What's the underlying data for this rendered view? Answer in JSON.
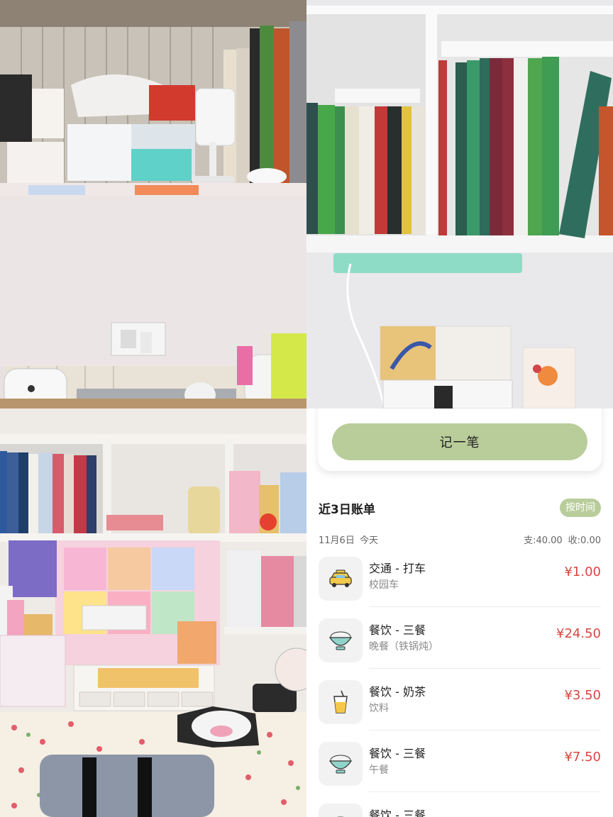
{
  "app": {
    "record_button_label": "记一笔",
    "section_title": "近3日账单",
    "sort_label": "按时间",
    "day": {
      "date": "11月6日",
      "label": "今天",
      "expense": "支:40.00",
      "income": "收:0.00"
    },
    "transactions": [
      {
        "category": "交通 - 打车",
        "note": "校园车",
        "amount": "¥1.00",
        "icon": "taxi-icon"
      },
      {
        "category": "餐饮 - 三餐",
        "note": "晚餐（铁锅炖）",
        "amount": "¥24.50",
        "icon": "rice-bowl-icon"
      },
      {
        "category": "餐饮 - 奶茶",
        "note": "饮料",
        "amount": "¥3.50",
        "icon": "drink-cup-icon"
      },
      {
        "category": "餐饮 - 三餐",
        "note": "午餐",
        "amount": "¥7.50",
        "icon": "rice-bowl-icon"
      },
      {
        "category": "餐饮 - 三餐",
        "note": "",
        "amount": "",
        "icon": "rice-bowl-icon"
      }
    ]
  },
  "colors": {
    "accent": "#b9cd9b",
    "amount": "#d8473f",
    "icon_bg": "#f2f2f2"
  }
}
